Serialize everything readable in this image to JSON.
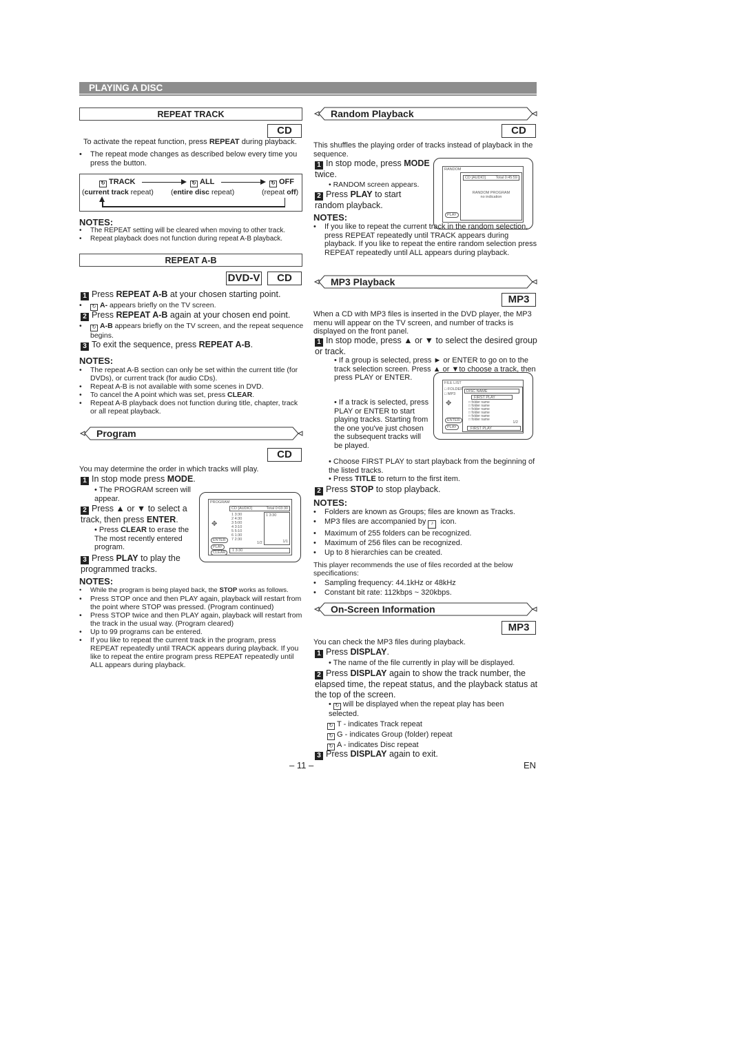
{
  "page": {
    "section_title": "PLAYING A DISC",
    "page_number": "– 11 –",
    "language": "EN"
  },
  "repeat_track": {
    "heading": "REPEAT TRACK",
    "badge": "CD",
    "intro_pre": "To activate the repeat function, press ",
    "intro_bold": "REPEAT",
    "intro_post": " during playback.",
    "bullet": "The repeat mode changes as described below every time you press the button.",
    "cycle": [
      {
        "label": "TRACK",
        "desc_bold": "current track",
        "desc": " repeat"
      },
      {
        "label": "ALL",
        "desc_bold": "entire disc",
        "desc": " repeat"
      },
      {
        "label": "OFF",
        "desc_pre": "repeat ",
        "desc_bold": "off"
      }
    ],
    "notes_title": "NOTES:",
    "notes": [
      "The REPEAT setting will be cleared when moving to other track.",
      "Repeat playback does not function during repeat A-B playback."
    ]
  },
  "repeat_ab": {
    "heading": "REPEAT A-B",
    "badges": [
      "DVD-V",
      "CD"
    ],
    "step1_pre": "Press ",
    "step1_bold": "REPEAT A-B",
    "step1_post": " at your chosen starting point.",
    "step1_bullet_bold": "A-",
    "step1_bullet": " appears briefly on the TV screen.",
    "step2_pre": "Press ",
    "step2_bold": "REPEAT A-B",
    "step2_post": " again at your chosen end point.",
    "step2_bullet_bold": "A-B",
    "step2_bullet": " appears briefly on the TV screen, and the repeat sequence begins.",
    "step3_pre": "To exit the sequence, press ",
    "step3_bold": "REPEAT A-B",
    "step3_post": ".",
    "notes_title": "NOTES:",
    "notes": [
      "The repeat A-B section can only be set within the current title (for DVDs), or current track (for audio CDs).",
      "Repeat A-B is not available with some scenes in DVD."
    ],
    "note3_pre": "To cancel the A point which was set, press ",
    "note3_bold": "CLEAR",
    "note3_post": ".",
    "note4": "Repeat A-B playback does not function during title, chapter, track or all repeat playback."
  },
  "program": {
    "heading": "Program",
    "badge": "CD",
    "intro": "You may determine the order in which tracks will play.",
    "step1_pre": "In stop mode press ",
    "step1_bold": "MODE",
    "step1_post": ".",
    "step1_bullet": "The PROGRAM screen will appear.",
    "step2_pre": "Press ▲ or ▼ to select a track, then press ",
    "step2_bold": "ENTER",
    "step2_post": ".",
    "step2_bullet_pre": "Press ",
    "step2_bullet_bold": "CLEAR",
    "step2_bullet_post": " to erase the The most recently entered program.",
    "step3_pre": "Press ",
    "step3_bold": "PLAY",
    "step3_post": " to play the programmed tracks.",
    "screen": {
      "title": "PROGRAM",
      "header_left": "CD [AUDIO]",
      "header_right": "Total 0:03:30",
      "tracks": [
        "1  3:30",
        "2  4:30",
        "3  5:00",
        "4  3:10",
        "5  5:10",
        "6  1:30",
        "7  2:30"
      ],
      "page": "1/2",
      "program_entry": "1  3:30",
      "program_page": "1/1",
      "bottom": "1  3:30",
      "buttons": [
        "ENTER",
        "PLAY",
        "CLEAR"
      ]
    },
    "notes_title": "NOTES:",
    "note1_pre": "While the program is being played back, the ",
    "note1_bold": "STOP",
    "note1_post": " works as follows.",
    "note2": "Press STOP once and then PLAY again, playback will restart from the point where STOP was pressed. (Program continued)",
    "note3": "Press STOP twice and then PLAY again, playback will restart from the track in the usual way. (Program cleared)",
    "note4": "Up to 99 programs can be entered.",
    "note5": "If you like to repeat the current track in the program, press REPEAT repeatedly until TRACK appears during playback. If you like to repeat the entire program press REPEAT repeatedly until ALL appears during playback."
  },
  "random": {
    "heading": "Random Playback",
    "badge": "CD",
    "intro": "This shuffles the playing order of tracks instead of playback in the sequence.",
    "step1_pre": "In stop mode, press ",
    "step1_bold": "MODE",
    "step1_post": " twice.",
    "step1_bullet": "RANDOM screen appears.",
    "step2_pre": "Press ",
    "step2_bold": "PLAY",
    "step2_post": " to start random playback.",
    "screen": {
      "title": "RANDOM",
      "header_left": "CD [AUDIO]",
      "header_right": "Total 0:45:59",
      "center_1": "RANDOM PROGRAM",
      "center_2": "no indication",
      "button": "PLAY"
    },
    "notes_title": "NOTES:",
    "note": "If you like to repeat the current track in the random selection, press REPEAT repeatedly until TRACK appears during playback. If you like to repeat the entire random selection press REPEAT repeatedly until ALL appears during playback."
  },
  "mp3": {
    "heading": "MP3 Playback",
    "badge": "MP3",
    "intro": "When a CD with MP3 files is inserted in the DVD player, the MP3 menu will appear on the TV screen, and number of tracks is displayed on the front panel.",
    "step1": "In stop mode, press ▲ or ▼ to select the desired group or track.",
    "bullet1": "If a group is selected, press ► or ENTER to go on to the track selection screen. Press ▲ or ▼to choose a track, then press PLAY or ENTER.",
    "bullet2": "If a track is selected, press PLAY or ENTER to start playing tracks. Starting from the one you've just chosen the subsequent tracks will be played.",
    "bullet3": "Choose FIRST PLAY to start playback from the beginning of the listed tracks.",
    "bullet4_pre": "Press ",
    "bullet4_bold": "TITLE",
    "bullet4_post": " to return to the first item.",
    "step2_pre": "Press ",
    "step2_bold": "STOP",
    "step2_post": " to stop playback.",
    "screen": {
      "title": "FILE LIST",
      "legend": [
        "FOLDER",
        "MP3"
      ],
      "disc_name": "DISC NAME",
      "first_play": "FIRST PLAY",
      "items": [
        "folder name",
        "folder name",
        "folder name",
        "folder name",
        "folder name",
        "folder name"
      ],
      "page": "1/2",
      "bottom": "FIRST PLAY",
      "buttons": [
        "ENTER",
        "PLAY"
      ]
    },
    "notes_title": "NOTES:",
    "notes": [
      "Folders are known as Groups; files are known as Tracks.",
      "MP3 files are accompanied by  icon.",
      "Maximum of 255 folders can be recognized.",
      "Maximum of 256 files can be recognized.",
      "Up to 8 hierarchies can be created."
    ],
    "spec_intro": "This player recommends the use of files recorded at the below specifications:",
    "specs": [
      "Sampling frequency: 44.1kHz or 48kHz",
      "Constant bit rate: 112kbps ~ 320kbps."
    ]
  },
  "onscreen": {
    "heading": "On-Screen Information",
    "badge": "MP3",
    "intro": "You can check the MP3 files during playback.",
    "step1_pre": "Press ",
    "step1_bold": "DISPLAY",
    "step1_post": ".",
    "step1_bullet": "The name of the file currently in play will be displayed.",
    "step2_pre": "Press ",
    "step2_bold": "DISPLAY",
    "step2_post": " again to show the track number, the elapsed time, the repeat status, and the playback status at the top of the screen.",
    "step2_bullet": "will be displayed when the repeat play has been selected.",
    "indicators": [
      "T - indicates Track repeat",
      "G - indicates Group (folder) repeat",
      "A - indicates Disc repeat"
    ],
    "step3_pre": "Press ",
    "step3_bold": "DISPLAY",
    "step3_post": " again to exit."
  },
  "icons": {
    "repeat_glyph": "↻",
    "mp3_glyph": "♪"
  }
}
